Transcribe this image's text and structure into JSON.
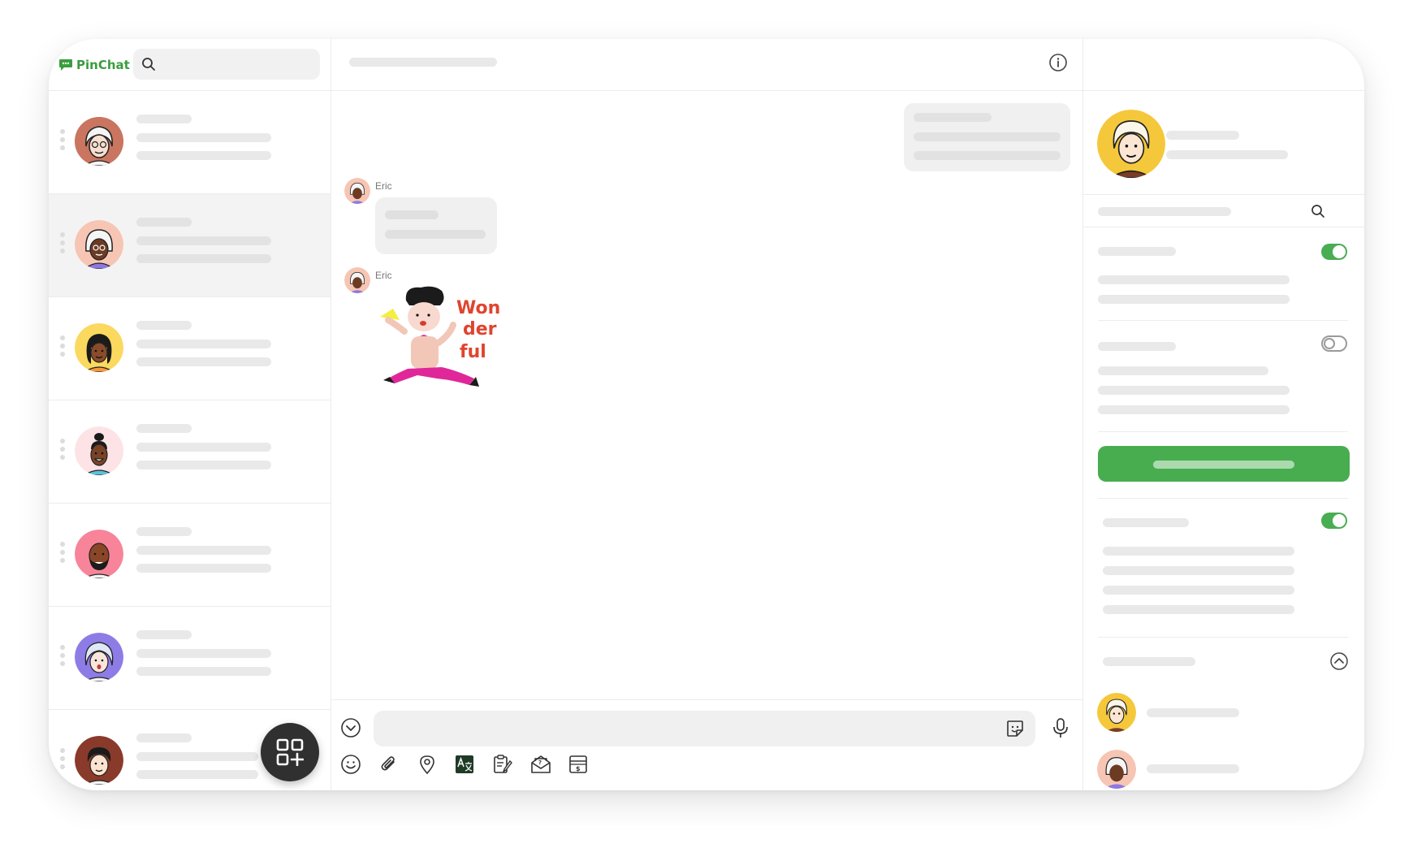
{
  "app": {
    "name": "PinChat",
    "brand_color": "#3a9d3f"
  },
  "search": {
    "placeholder": ""
  },
  "chat_list": [
    {
      "id": "c1",
      "avatar": "gray-hair-glasses-avatar",
      "active": false
    },
    {
      "id": "c2",
      "avatar": "white-hair-woman-avatar",
      "active": true
    },
    {
      "id": "c3",
      "avatar": "yellow-bg-woman-avatar",
      "active": false
    },
    {
      "id": "c4",
      "avatar": "bun-hair-man-avatar",
      "active": false
    },
    {
      "id": "c5",
      "avatar": "bald-bearded-man-avatar",
      "active": false
    },
    {
      "id": "c6",
      "avatar": "purple-bg-woman-avatar",
      "active": false
    },
    {
      "id": "c7",
      "avatar": "brown-hair-man-avatar",
      "active": false
    }
  ],
  "conversation": {
    "messages": [
      {
        "type": "text",
        "direction": "outgoing"
      },
      {
        "type": "text",
        "direction": "incoming",
        "sender": "Eric"
      },
      {
        "type": "sticker",
        "direction": "incoming",
        "sender": "Eric",
        "sticker_text": "Won der ful"
      }
    ]
  },
  "composer": {
    "tools": [
      "emoji-icon",
      "attach-icon",
      "location-icon",
      "translate-icon",
      "notes-icon",
      "mail-icon",
      "payment-icon"
    ]
  },
  "profile_panel": {
    "toggles": [
      true,
      false,
      true
    ],
    "accent": "#48ad4f"
  }
}
